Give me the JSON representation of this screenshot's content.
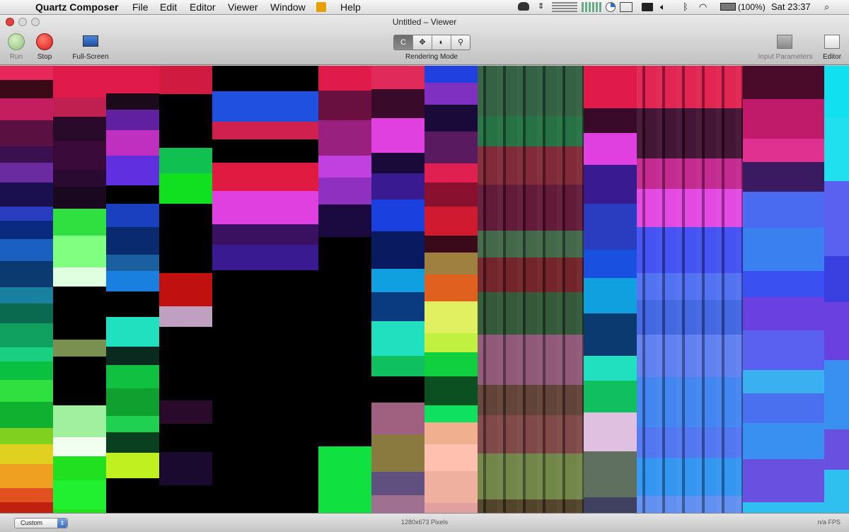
{
  "menubar": {
    "app_name": "Quartz Composer",
    "menus": [
      "File",
      "Edit",
      "Editor",
      "Viewer",
      "Window",
      "Help"
    ],
    "battery": "(100%)",
    "clock": "Sat 23:37"
  },
  "window": {
    "title": "Untitled – Viewer"
  },
  "toolbar": {
    "run_label": "Run",
    "stop_label": "Stop",
    "fullscreen_label": "Full-Screen",
    "rendering_mode_label": "Rendering Mode",
    "input_parameters_label": "Input Parameters",
    "editor_label": "Editor",
    "mode_glyphs": [
      "C",
      "✥",
      "◐",
      "⚲"
    ]
  },
  "statusbar": {
    "size_option": "Custom",
    "resolution": "1280x673 Pixels",
    "fps": "n/a FPS"
  },
  "icons": {
    "apple": "apple-icon",
    "search": "spotlight-icon",
    "wifi": "wifi-icon",
    "volume": "volume-icon",
    "bluetooth": "bluetooth-icon",
    "battery": "battery-icon"
  },
  "colors": {
    "run_green": "#5fae3e",
    "stop_red": "#d81c1c",
    "popup_blue": "#3c6fc0"
  }
}
